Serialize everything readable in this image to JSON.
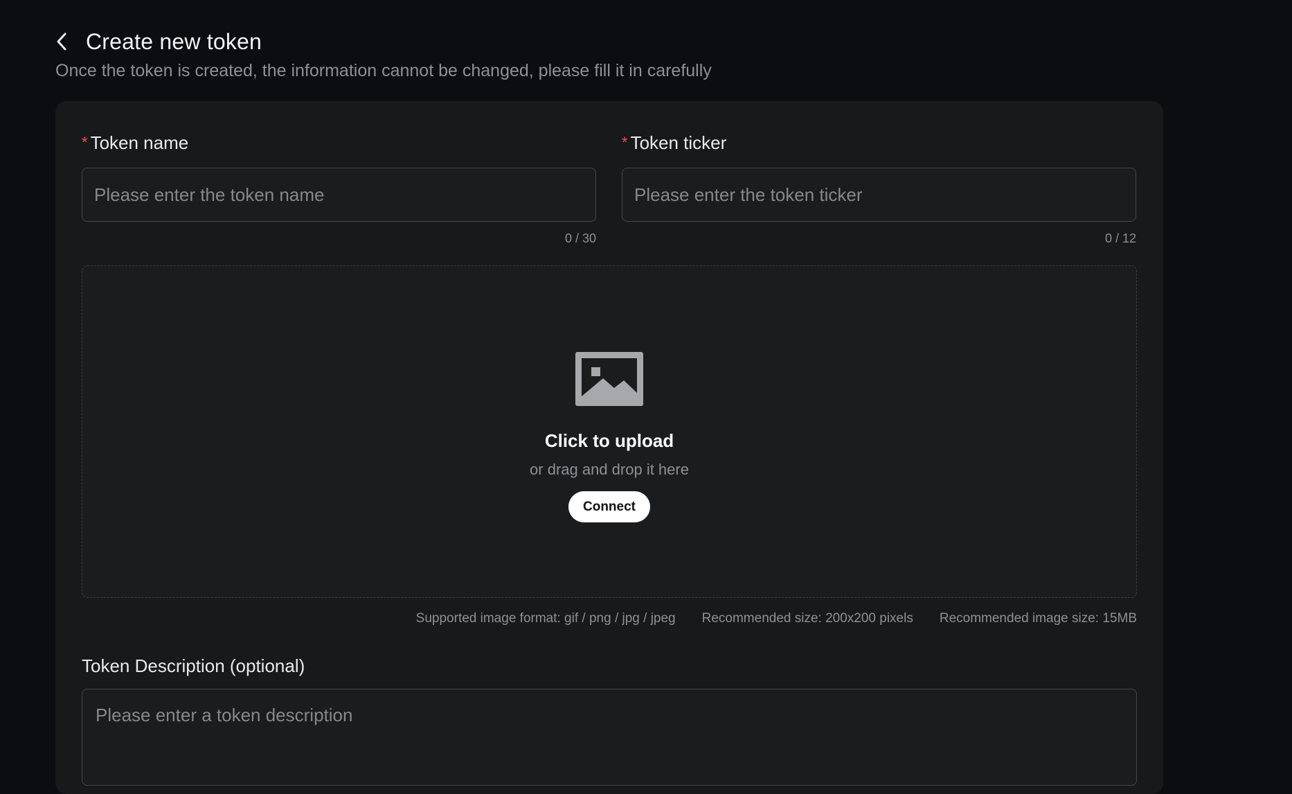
{
  "header": {
    "back_icon": "chevron-left-icon",
    "title": "Create new token",
    "subtitle": "Once the token is created, the information cannot be changed, please fill it in carefully"
  },
  "form": {
    "required_mark": "*",
    "token_name": {
      "label": "Token name",
      "placeholder": "Please enter the token name",
      "value": "",
      "counter": "0 / 30"
    },
    "token_ticker": {
      "label": "Token ticker",
      "placeholder": "Please enter the token ticker",
      "value": "",
      "counter": "0 / 12"
    },
    "upload": {
      "icon": "image-icon",
      "title": "Click to upload",
      "subtitle": "or drag and drop it here",
      "button_label": "Connect"
    },
    "hints": {
      "format": "Supported image format: gif / png / jpg / jpeg",
      "recommended_size": "Recommended size: 200x200 pixels",
      "max_file_size": "Recommended image size: 15MB"
    },
    "description": {
      "label": "Token Description (optional)",
      "placeholder": "Please enter a token description",
      "value": ""
    }
  },
  "colors": {
    "page_background": "#0b0d10",
    "card_background": "#17191b",
    "required_mark": "#ff4d4f",
    "muted_text": "#8d9096",
    "button_background": "#ffffff"
  }
}
